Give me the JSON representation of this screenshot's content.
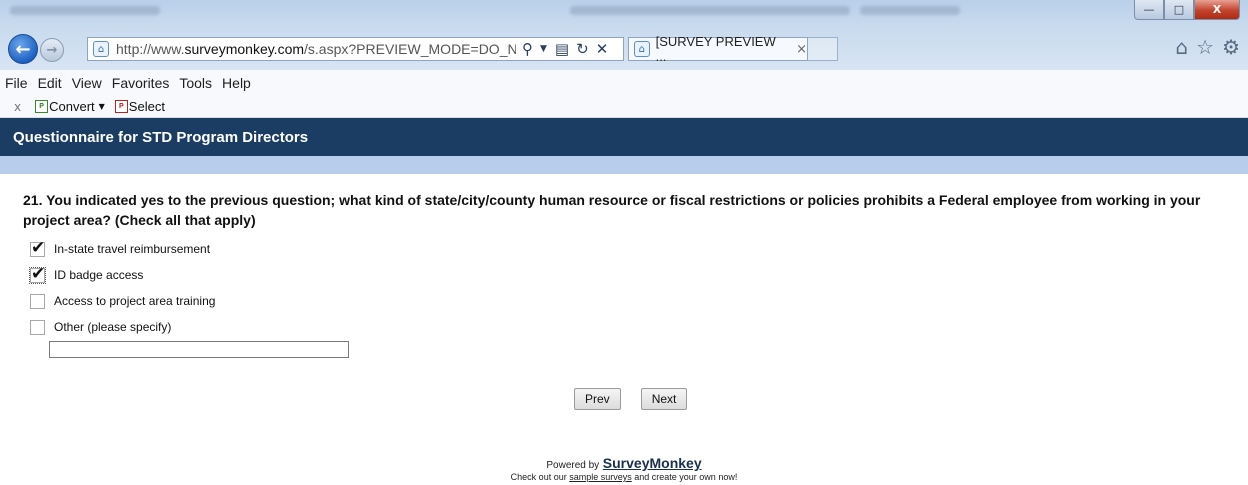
{
  "browser": {
    "url_prefix": "http://www.",
    "url_domain": "surveymonkey.com",
    "url_rest": "/s.aspx?PREVIEW_MODE=DO_NOT",
    "tab_title": "[SURVEY PREVIEW ...",
    "tab_close": "×",
    "back_glyph": "←",
    "forward_glyph": "→",
    "window_minimize": "—",
    "window_maximize": "□",
    "window_close": "X"
  },
  "menubar": {
    "items": [
      "File",
      "Edit",
      "View",
      "Favorites",
      "Tools",
      "Help"
    ]
  },
  "toolbar": {
    "close_glyph": "x",
    "convert_label": "Convert",
    "select_label": "Select"
  },
  "survey": {
    "title": "Questionnaire for STD Program Directors",
    "question": "21. You indicated yes to the previous question; what kind of state/city/county human resource or fiscal restrictions or policies prohibits a Federal employee from working in your project area? (Check all that apply)",
    "options": [
      {
        "label": "In-state travel reimbursement",
        "checked": true
      },
      {
        "label": "ID badge access",
        "checked": true
      },
      {
        "label": "Access to project area training",
        "checked": false
      },
      {
        "label": "Other (please specify)",
        "checked": false
      }
    ],
    "other_value": "",
    "prev_label": "Prev",
    "next_label": "Next"
  },
  "footer": {
    "powered_by": "Powered by",
    "brand": "SurveyMonkey",
    "line_prefix": "Check out our",
    "link_text": "sample surveys",
    "line_suffix": "and create your own now!"
  }
}
